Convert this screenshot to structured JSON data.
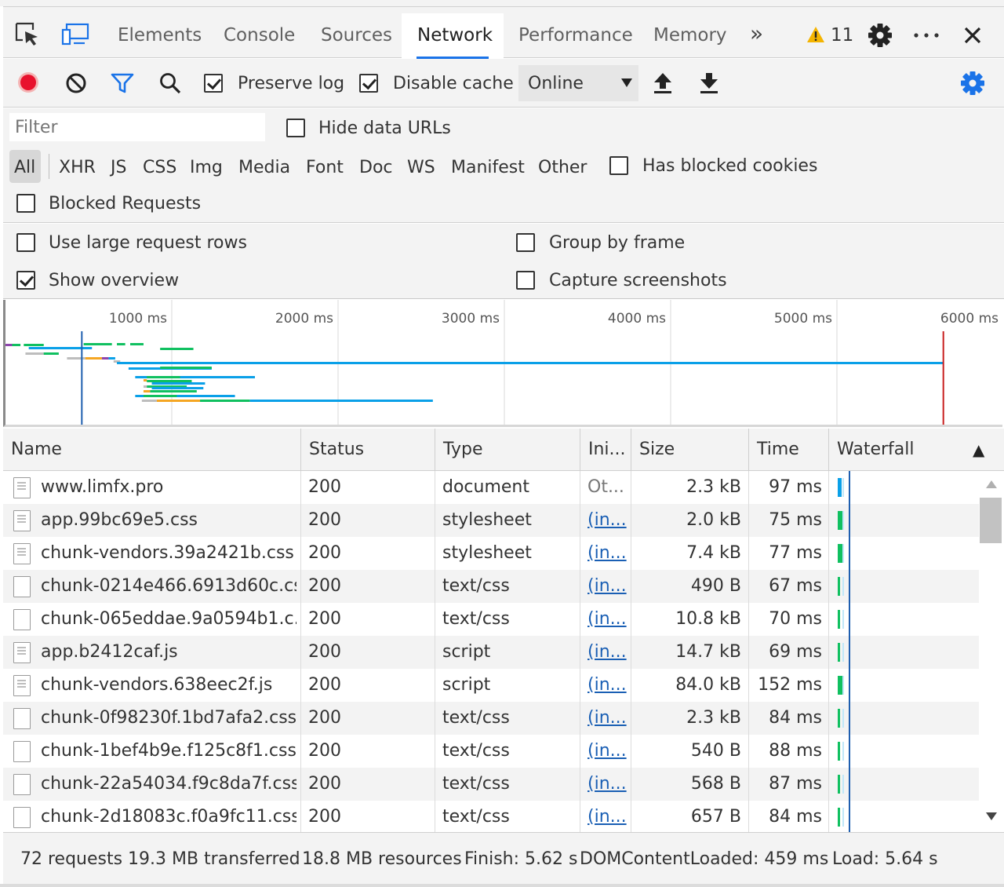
{
  "devtools": {
    "tabs": [
      "Elements",
      "Console",
      "Sources",
      "Network",
      "Performance",
      "Memory"
    ],
    "active_tab": "Network",
    "more_tabs": "»",
    "warning_count": "11"
  },
  "toolbar": {
    "preserve_log_label": "Preserve log",
    "preserve_log_checked": true,
    "disable_cache_label": "Disable cache",
    "disable_cache_checked": true,
    "throttling_value": "Online"
  },
  "filter": {
    "placeholder": "Filter",
    "hide_data_urls_label": "Hide data URLs",
    "types": [
      "All",
      "XHR",
      "JS",
      "CSS",
      "Img",
      "Media",
      "Font",
      "Doc",
      "WS",
      "Manifest",
      "Other"
    ],
    "active_type": "All",
    "has_blocked_cookies_label": "Has blocked cookies",
    "blocked_requests_label": "Blocked Requests"
  },
  "settings": {
    "large_rows_label": "Use large request rows",
    "large_rows_checked": false,
    "show_overview_label": "Show overview",
    "show_overview_checked": true,
    "group_by_frame_label": "Group by frame",
    "group_by_frame_checked": false,
    "capture_screenshots_label": "Capture screenshots",
    "capture_screenshots_checked": false
  },
  "overview": {
    "ticks": [
      "1000 ms",
      "2000 ms",
      "3000 ms",
      "4000 ms",
      "5000 ms",
      "6000 ms"
    ],
    "dom_content_loaded_ms": 459,
    "load_ms": 5640
  },
  "table": {
    "columns": [
      "Name",
      "Status",
      "Type",
      "Ini...",
      "Size",
      "Time",
      "Waterfall"
    ],
    "sort_indicator": "▲",
    "rows": [
      {
        "name": "www.limfx.pro",
        "status": "200",
        "type": "document",
        "initiator": "Ot...",
        "size": "2.3 kB",
        "time": "97 ms",
        "icon": "document-icon"
      },
      {
        "name": "app.99bc69e5.css",
        "status": "200",
        "type": "stylesheet",
        "initiator": "(in...",
        "size": "2.0 kB",
        "time": "75 ms",
        "icon": "document-icon"
      },
      {
        "name": "chunk-vendors.39a2421b.css",
        "status": "200",
        "type": "stylesheet",
        "initiator": "(in...",
        "size": "7.4 kB",
        "time": "77 ms",
        "icon": "document-icon"
      },
      {
        "name": "chunk-0214e466.6913d60c.css",
        "status": "200",
        "type": "text/css",
        "initiator": "(in...",
        "size": "490 B",
        "time": "67 ms",
        "icon": "blank-file-icon"
      },
      {
        "name": "chunk-065eddae.9a0594b1.c...",
        "status": "200",
        "type": "text/css",
        "initiator": "(in...",
        "size": "10.8 kB",
        "time": "70 ms",
        "icon": "blank-file-icon"
      },
      {
        "name": "app.b2412caf.js",
        "status": "200",
        "type": "script",
        "initiator": "(in...",
        "size": "14.7 kB",
        "time": "69 ms",
        "icon": "document-icon"
      },
      {
        "name": "chunk-vendors.638eec2f.js",
        "status": "200",
        "type": "script",
        "initiator": "(in...",
        "size": "84.0 kB",
        "time": "152 ms",
        "icon": "document-icon"
      },
      {
        "name": "chunk-0f98230f.1bd7afa2.css",
        "status": "200",
        "type": "text/css",
        "initiator": "(in...",
        "size": "2.3 kB",
        "time": "84 ms",
        "icon": "blank-file-icon"
      },
      {
        "name": "chunk-1bef4b9e.f125c8f1.css",
        "status": "200",
        "type": "text/css",
        "initiator": "(in...",
        "size": "540 B",
        "time": "88 ms",
        "icon": "blank-file-icon"
      },
      {
        "name": "chunk-22a54034.f9c8da7f.css",
        "status": "200",
        "type": "text/css",
        "initiator": "(in...",
        "size": "568 B",
        "time": "87 ms",
        "icon": "blank-file-icon"
      },
      {
        "name": "chunk-2d18083c.f0a9fc11.css",
        "status": "200",
        "type": "text/css",
        "initiator": "(in...",
        "size": "657 B",
        "time": "84 ms",
        "icon": "blank-file-icon"
      }
    ]
  },
  "status": {
    "requests": "72 requests",
    "transferred": "19.3 MB transferred",
    "resources": "18.8 MB resources",
    "finish": "Finish: 5.62 s",
    "dom_content_loaded": "DOMContentLoaded: 459 ms",
    "load": "Load: 5.64 s"
  },
  "colors": {
    "record": "#e8112d",
    "accent_blue": "#1a73e8",
    "waterfall_blue": "#0aa0e8",
    "waterfall_green": "#10c060",
    "waterfall_orange": "#f5a623",
    "waterfall_purple": "#8e44ad",
    "load_line": "#c81e1e",
    "warning": "#f4b400"
  }
}
